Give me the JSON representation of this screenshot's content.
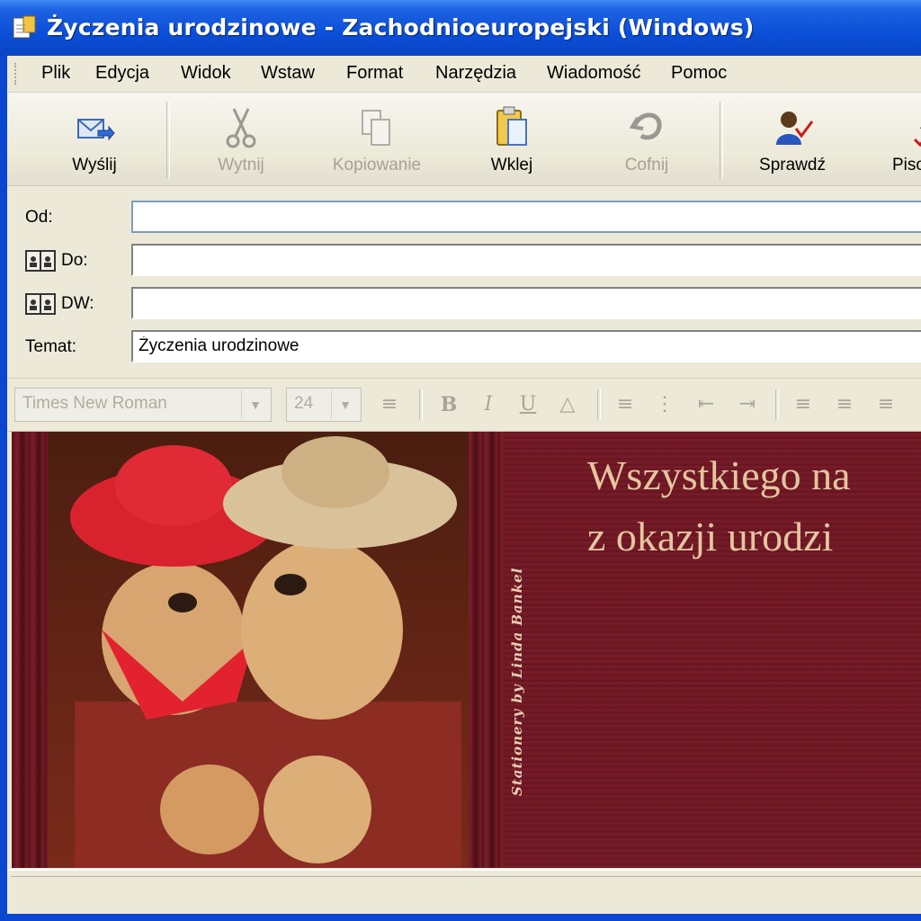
{
  "window": {
    "title": "Życzenia urodzinowe - Zachodnioeuropejski (Windows)"
  },
  "menu": {
    "items": [
      "Plik",
      "Edycja",
      "Widok",
      "Wstaw",
      "Format",
      "Narzędzia",
      "Wiadomość",
      "Pomoc"
    ]
  },
  "toolbar": {
    "send": "Wyślij",
    "cut": "Wytnij",
    "copy": "Kopiowanie",
    "paste": "Wklej",
    "undo": "Cofnij",
    "check": "Sprawdź",
    "spelling": "Piso"
  },
  "header": {
    "from_label": "Od:",
    "from_value": "",
    "to_label": "Do:",
    "to_value": "",
    "cc_label": "DW:",
    "cc_value": "",
    "subject_label": "Temat:",
    "subject_value": "Życzenia urodzinowe"
  },
  "format": {
    "font": "Times New Roman",
    "size": "24"
  },
  "body": {
    "greeting_line1": "Wszystkiego na",
    "greeting_line2": "z okazji urodzi",
    "credit": "Stationery by Linda Bankel"
  },
  "colors": {
    "titlebar": "#0a4fd8",
    "chrome": "#ece9d8",
    "stationery": "#6d1622",
    "greeting_text": "#e4c59f"
  }
}
